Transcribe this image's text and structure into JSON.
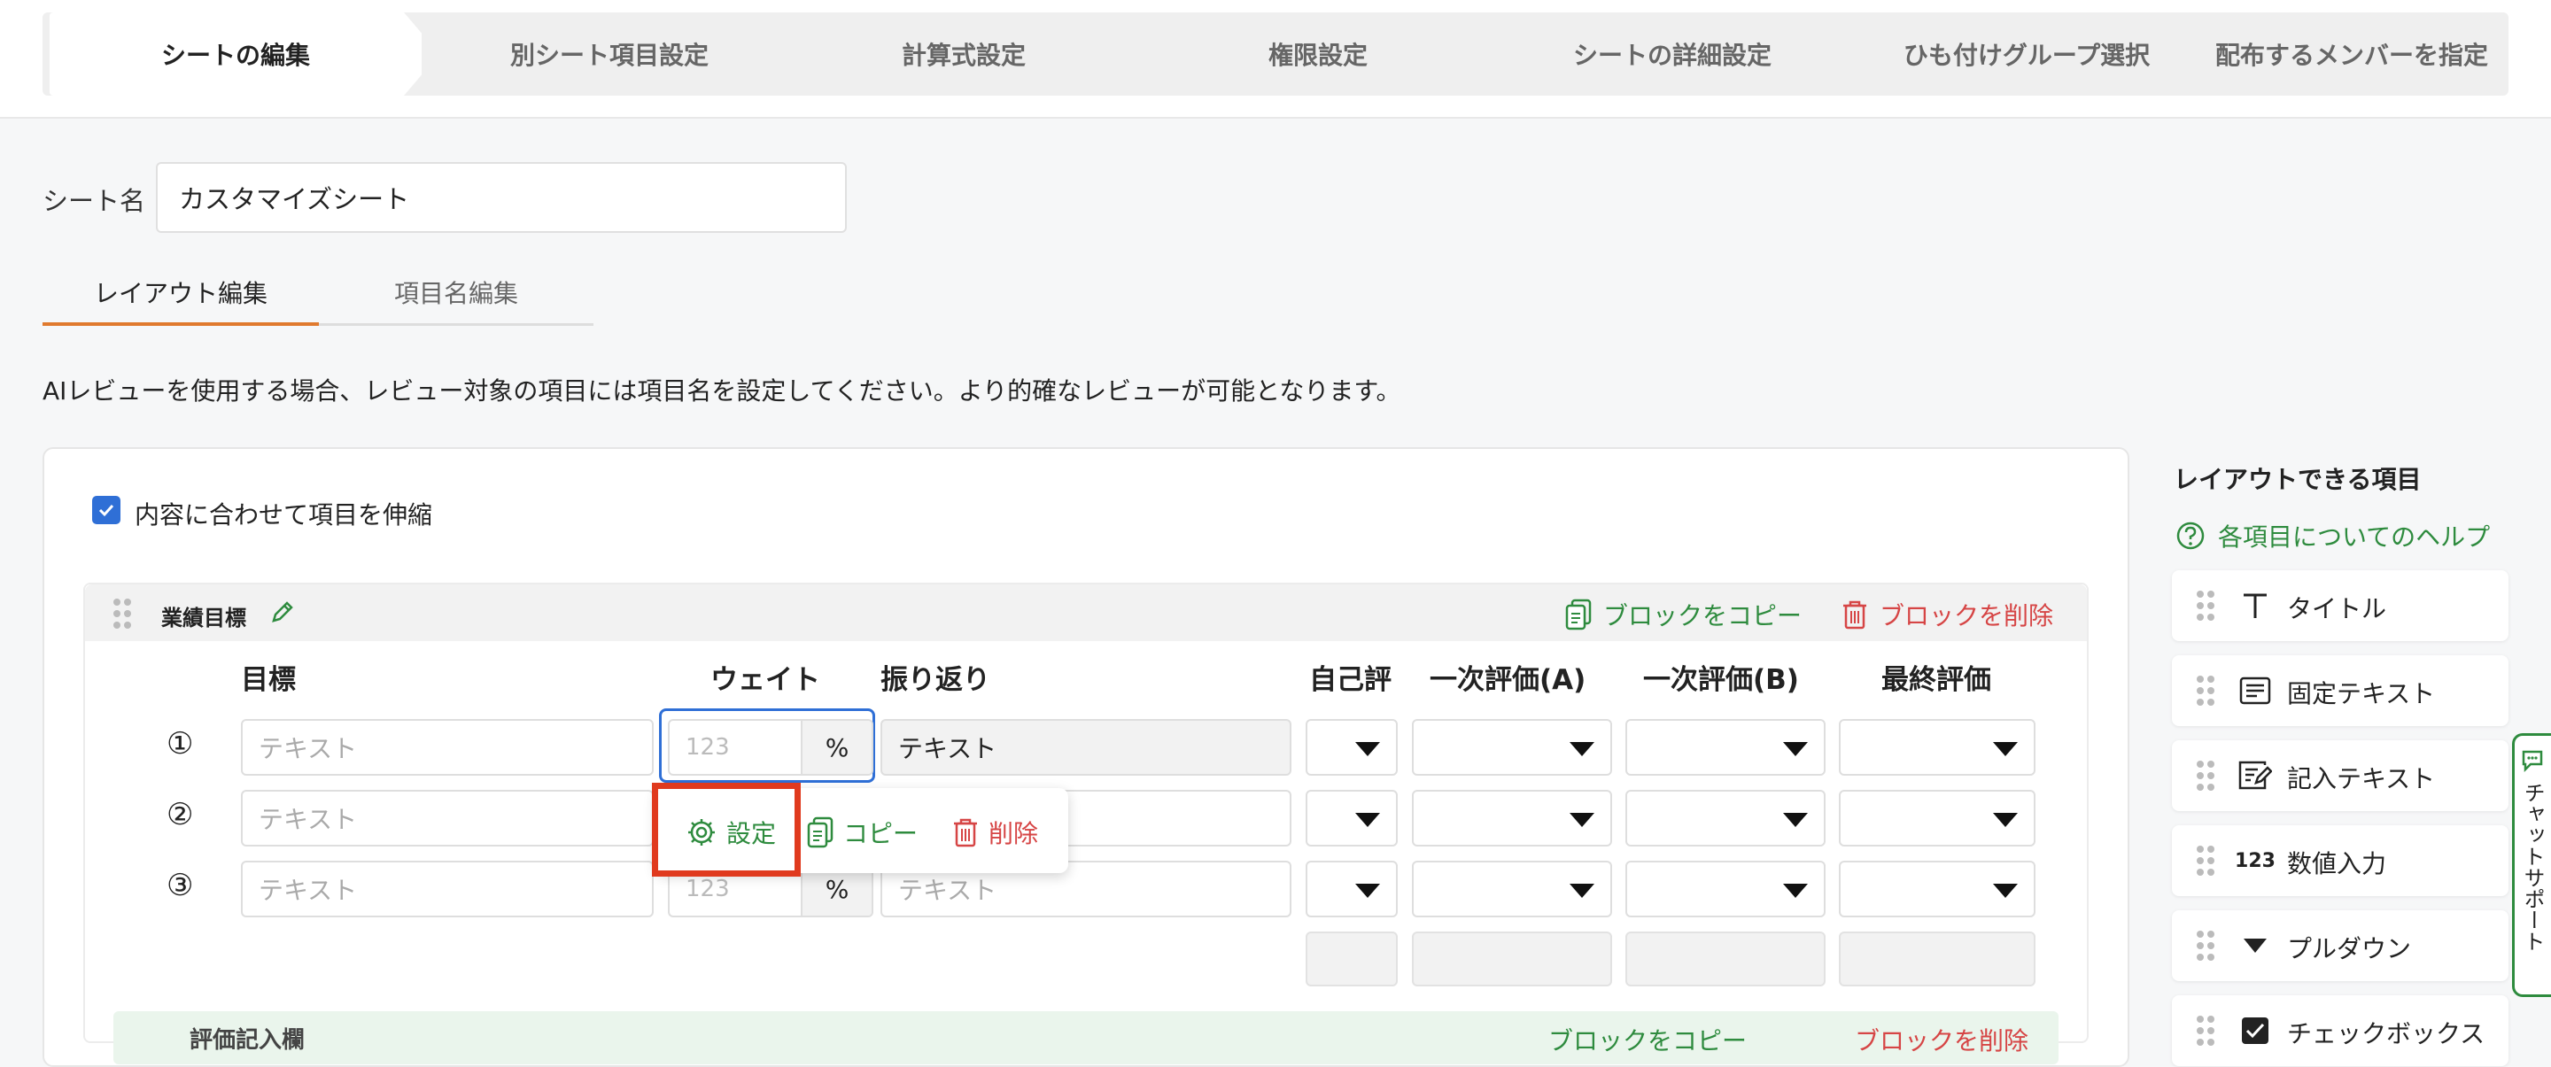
{
  "steps": [
    "シートの編集",
    "別シート項目設定",
    "計算式設定",
    "権限設定",
    "シートの詳細設定",
    "ひも付けグループ選択",
    "配布するメンバーを指定"
  ],
  "sheet": {
    "label": "シート名",
    "value": "カスタマイズシート"
  },
  "tabs": [
    "レイアウト編集",
    "項目名編集"
  ],
  "notice": "AIレビューを使用する場合、レビュー対象の項目には項目名を設定してください。より的確なレビューが可能となります。",
  "stretch_label": "内容に合わせて項目を伸縮",
  "block": {
    "title": "業績目標",
    "copy": "ブロックをコピー",
    "delete": "ブロックを削除"
  },
  "columns": [
    "目標",
    "ウェイト",
    "振り返り",
    "自己評",
    "一次評価(A)",
    "一次評価(B)",
    "最終評価"
  ],
  "rows": [
    "①",
    "②",
    "③"
  ],
  "placeholder": {
    "text": "テキスト",
    "number": "123",
    "percent": "%",
    "reflection": "テキスト"
  },
  "popup": {
    "settings": "設定",
    "copy": "コピー",
    "delete": "削除"
  },
  "block2": {
    "title": "評価記入欄",
    "copy": "ブロックをコピー",
    "delete": "ブロックを削除"
  },
  "sidebar": {
    "title": "レイアウトできる項目",
    "help": "各項目についてのヘルプ",
    "items": [
      {
        "label": "タイトル",
        "icon": "title-icon"
      },
      {
        "label": "固定テキスト",
        "icon": "fixed-text-icon"
      },
      {
        "label": "記入テキスト",
        "icon": "input-text-icon"
      },
      {
        "label": "数値入力",
        "icon": "number-icon",
        "glyph": "123"
      },
      {
        "label": "プルダウン",
        "icon": "dropdown-icon"
      },
      {
        "label": "チェックボックス",
        "icon": "checkbox-icon"
      }
    ]
  },
  "chat_support": "チャットサポート",
  "colors": {
    "accent": "#e07a2e",
    "green": "#2e8b3e",
    "red": "#d64545",
    "blue": "#2f6fd6",
    "highlight": "#e03a1e"
  }
}
